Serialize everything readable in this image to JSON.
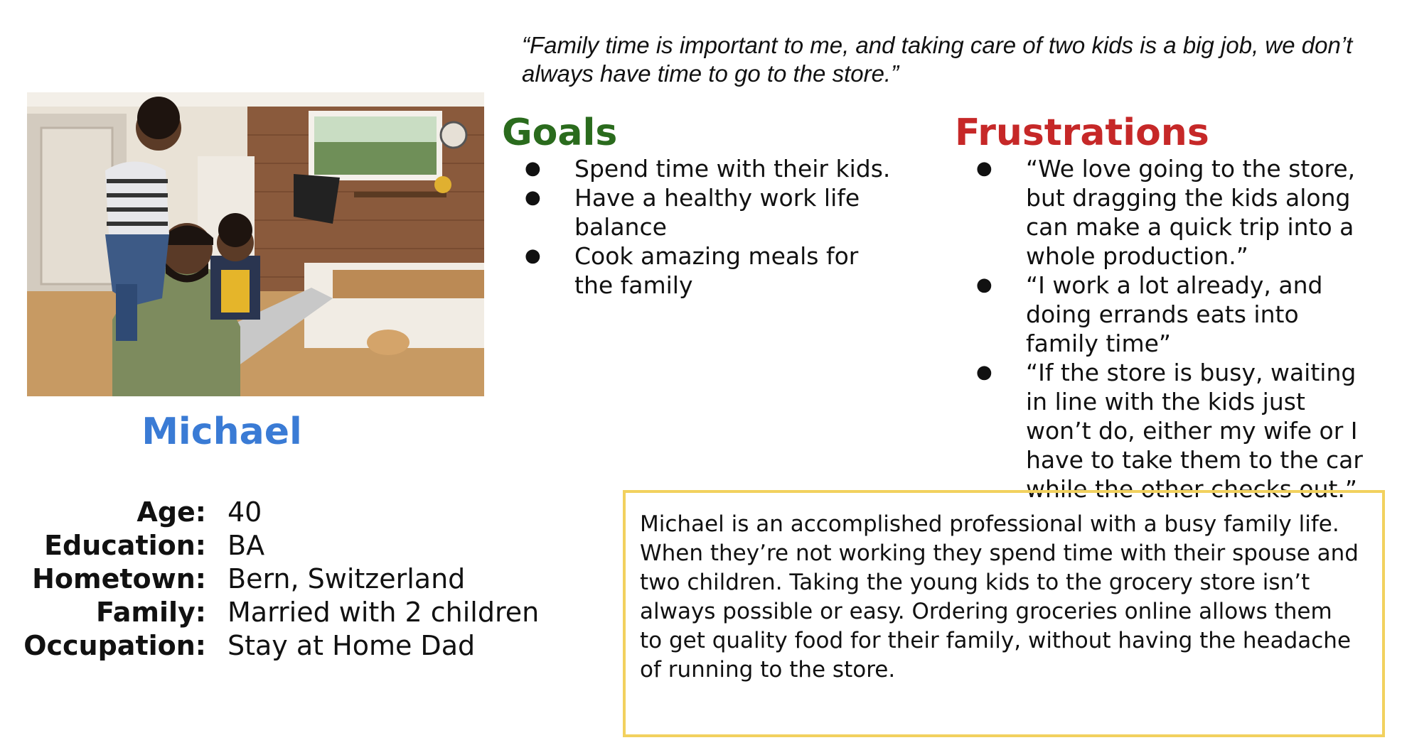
{
  "quote": "“Family time is important to me, and taking care of two kids is a big job, we don’t always have time to go to the store.”",
  "persona": {
    "name": "Michael",
    "name_color": "#3a7bd5",
    "details": [
      {
        "label": "Age:",
        "value": "40"
      },
      {
        "label": "Education:",
        "value": "BA"
      },
      {
        "label": "Hometown:",
        "value": "Bern, Switzerland"
      },
      {
        "label": "Family:",
        "value": "Married with 2 children"
      },
      {
        "label": "Occupation:",
        "value": "Stay at Home Dad"
      }
    ]
  },
  "goals": {
    "heading": "Goals",
    "color": "#2a6b1d",
    "items": [
      "Spend time with their kids.",
      "Have a healthy work life balance",
      "Cook amazing meals for the family"
    ]
  },
  "frustrations": {
    "heading": "Frustrations",
    "color": "#c62828",
    "items": [
      "“We love going to the store, but dragging the kids along can make a quick trip into a whole production.”",
      "“I work a lot already, and doing errands eats into family time”",
      "“If the store is busy, waiting in line with the kids just won’t do, either my wife or I have to take them to the car while the other checks out.”"
    ]
  },
  "bio": {
    "text": "Michael is an accomplished professional with a busy family life. When they’re not working they spend time with their spouse and two children. Taking the young kids to the grocery store isn’t always possible or easy. Ordering groceries online allows them to get quality food for their family, without having the headache of running to the store.",
    "border_color": "#f2d15e"
  },
  "bullet_glyph": "●"
}
